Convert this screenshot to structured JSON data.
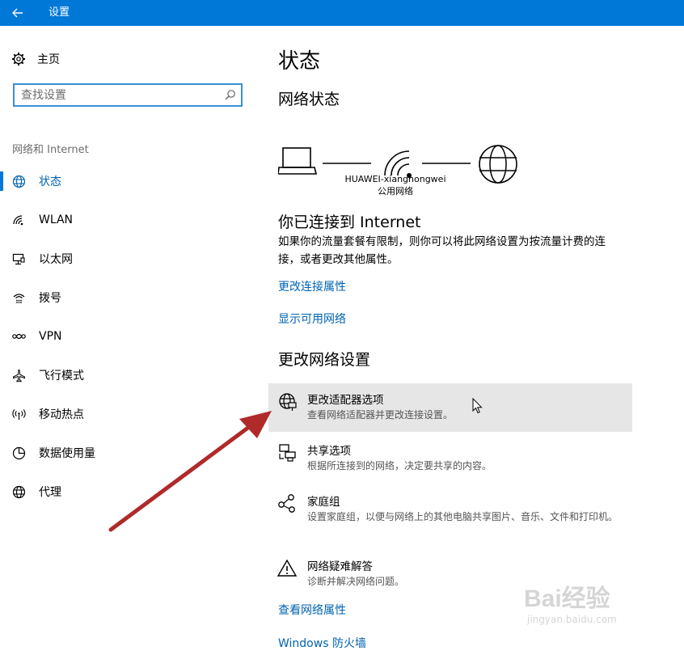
{
  "window": {
    "title": "设置"
  },
  "sidebar": {
    "home_label": "主页",
    "search_placeholder": "查找设置",
    "section_title": "网络和 Internet",
    "items": [
      {
        "label": "状态",
        "icon": "globe-icon",
        "active": true
      },
      {
        "label": "WLAN",
        "icon": "wifi-icon"
      },
      {
        "label": "以太网",
        "icon": "ethernet-icon"
      },
      {
        "label": "拨号",
        "icon": "dialup-icon"
      },
      {
        "label": "VPN",
        "icon": "vpn-icon"
      },
      {
        "label": "飞行模式",
        "icon": "airplane-icon"
      },
      {
        "label": "移动热点",
        "icon": "hotspot-icon"
      },
      {
        "label": "数据使用量",
        "icon": "data-usage-icon"
      },
      {
        "label": "代理",
        "icon": "proxy-globe-icon"
      }
    ]
  },
  "main": {
    "page_title": "状态",
    "network_status_heading": "网络状态",
    "network_name": "HUAWEI-xianghongwei",
    "network_type": "公用网络",
    "connected_heading": "你已连接到 Internet",
    "connected_desc": "如果你的流量套餐有限制，则你可以将此网络设置为按流量计费的连接，或者更改其他属性。",
    "links_top": [
      "更改连接属性",
      "显示可用网络"
    ],
    "change_settings_heading": "更改网络设置",
    "options": [
      {
        "title": "更改适配器选项",
        "desc": "查看网络适配器并更改连接设置。",
        "icon": "adapter-globe-icon"
      },
      {
        "title": "共享选项",
        "desc": "根据所连接到的网络，决定要共享的内容。",
        "icon": "sharing-icon"
      },
      {
        "title": "家庭组",
        "desc": "设置家庭组，以便与网络上的其他电脑共享图片、音乐、文件和打印机。",
        "icon": "homegroup-icon"
      },
      {
        "title": "网络疑难解答",
        "desc": "诊断并解决网络问题。",
        "icon": "warning-icon"
      }
    ],
    "links_bottom": [
      "查看网络属性",
      "Windows 防火墙"
    ]
  },
  "watermark": {
    "text": "Bai经验",
    "subtext": "jingyan.baidu.com"
  },
  "colors": {
    "accent": "#0078d7",
    "link": "#0063b1",
    "annotation_arrow": "#b02a2a"
  }
}
